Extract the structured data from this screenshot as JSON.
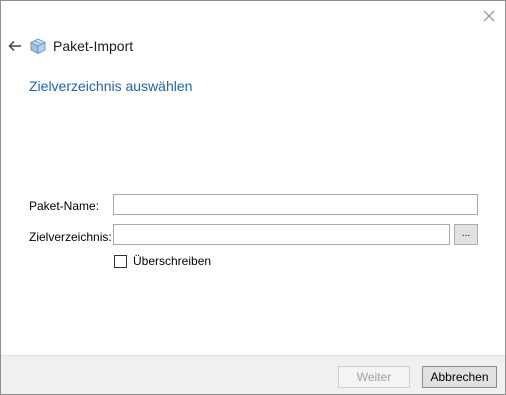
{
  "window": {
    "close_icon": "close-icon"
  },
  "header": {
    "back_icon": "arrow-left-icon",
    "app_icon": "package-icon",
    "title": "Paket-Import"
  },
  "section": {
    "title": "Zielverzeichnis auswählen"
  },
  "form": {
    "package_name_label": "Paket-Name:",
    "package_name_value": "",
    "target_dir_label": "Zielverzeichnis:",
    "target_dir_value": "",
    "browse_label": "...",
    "overwrite_label": "Überschreiben",
    "overwrite_checked": false
  },
  "footer": {
    "next_label": "Weiter",
    "next_enabled": false,
    "cancel_label": "Abbrechen"
  },
  "colors": {
    "accent": "#1e64b4",
    "footer_bg": "#f0f0f0"
  }
}
